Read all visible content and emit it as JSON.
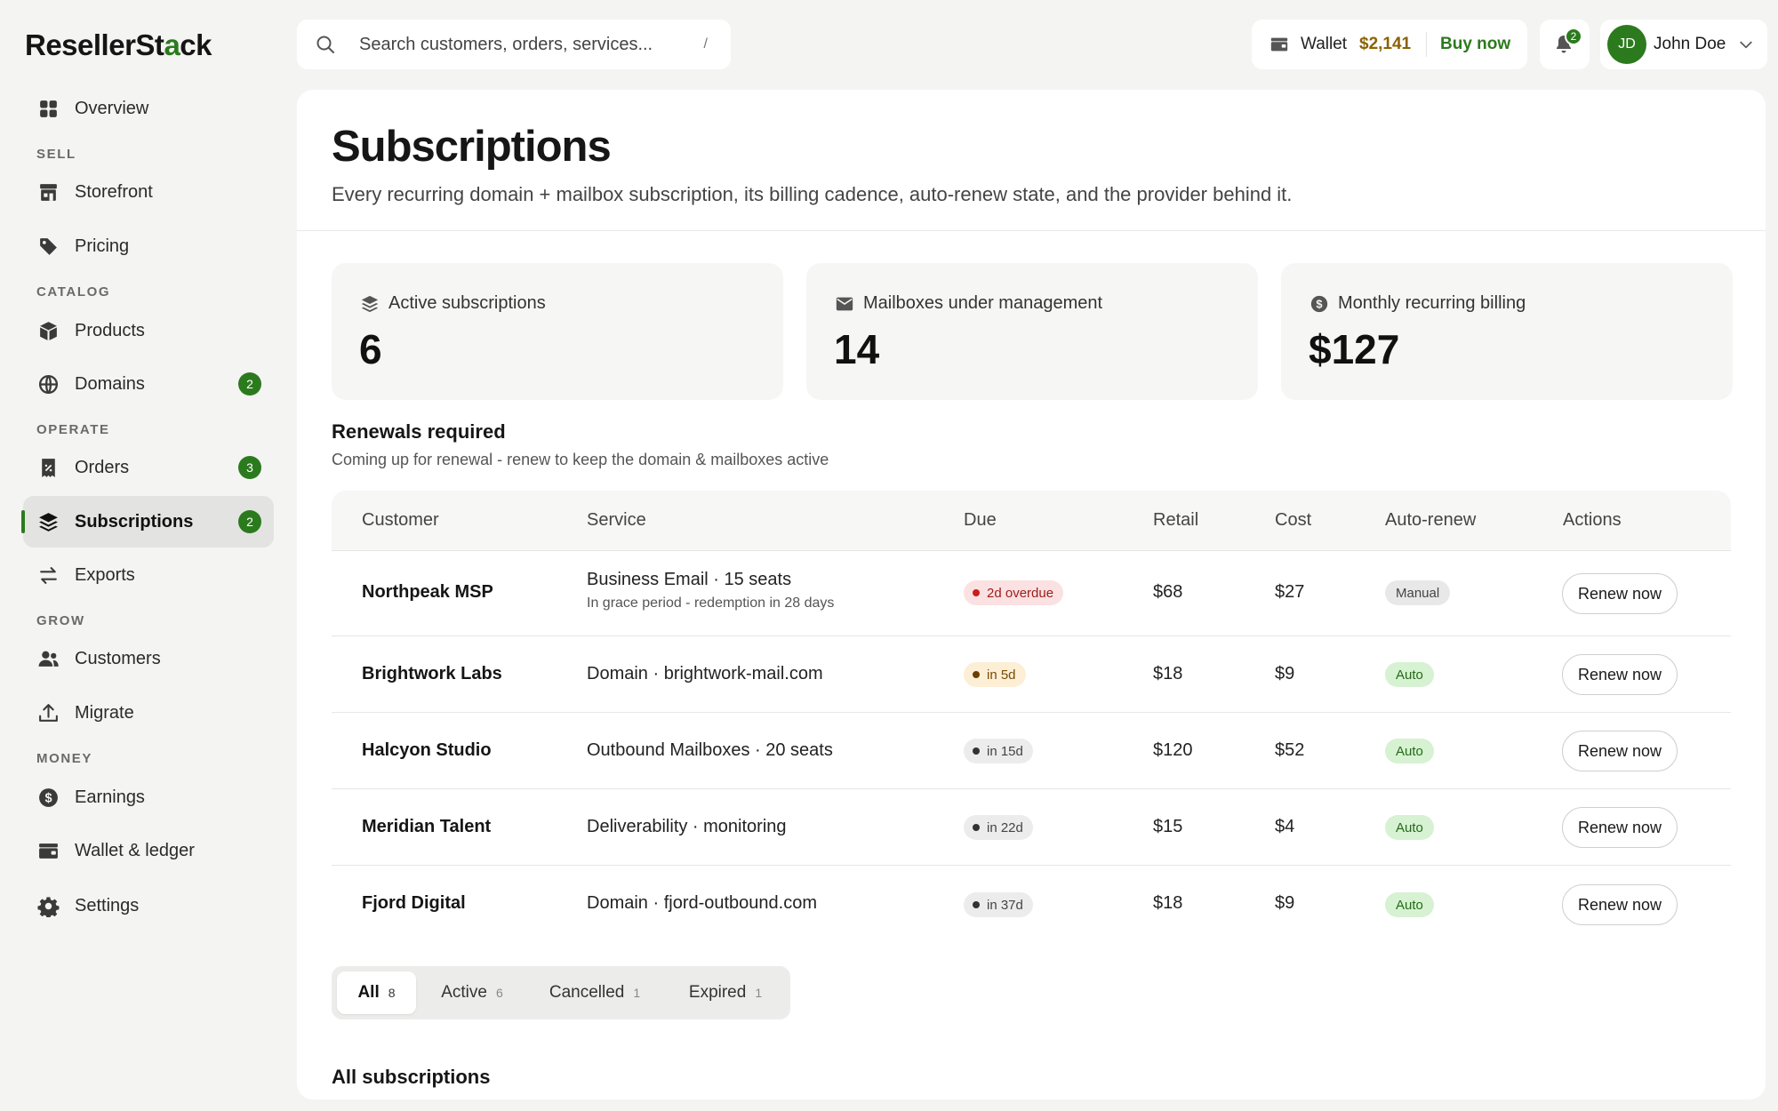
{
  "app": {
    "logo_text_a": "ResellerSt",
    "logo_text_b": "a",
    "logo_text_c": "ck"
  },
  "sidebar": {
    "items": [
      {
        "label": "Overview",
        "icon": "grid-icon"
      },
      {
        "label": "Storefront",
        "icon": "storefront-icon"
      },
      {
        "label": "Pricing",
        "icon": "tag-icon"
      },
      {
        "label": "Products",
        "icon": "box-icon"
      },
      {
        "label": "Domains",
        "icon": "globe-icon",
        "badge": "2"
      },
      {
        "label": "Orders",
        "icon": "receipt-icon",
        "badge": "3"
      },
      {
        "label": "Subscriptions",
        "icon": "layers-icon",
        "badge": "2",
        "active": true
      },
      {
        "label": "Exports",
        "icon": "arrows-icon"
      },
      {
        "label": "Customers",
        "icon": "users-icon"
      },
      {
        "label": "Migrate",
        "icon": "upload-icon"
      },
      {
        "label": "Earnings",
        "icon": "dollar-icon"
      },
      {
        "label": "Wallet & ledger",
        "icon": "wallet-icon"
      },
      {
        "label": "Settings",
        "icon": "gear-icon"
      }
    ],
    "sections": {
      "sell": "SELL",
      "catalog": "CATALOG",
      "operate": "OPERATE",
      "grow": "GROW",
      "money": "MONEY"
    }
  },
  "topbar": {
    "search_placeholder": "Search customers, orders, services...",
    "search_shortcut": "/",
    "wallet_label": "Wallet",
    "wallet_amount": "$2,141",
    "buy_now": "Buy now",
    "notifications_count": "2",
    "user_initials": "JD",
    "user_name": "John Doe"
  },
  "page": {
    "title": "Subscriptions",
    "subtitle": "Every recurring domain + mailbox subscription, its billing cadence, auto-renew state, and the provider behind it."
  },
  "stats": [
    {
      "label": "Active subscriptions",
      "value": "6",
      "icon": "layers-icon"
    },
    {
      "label": "Mailboxes under management",
      "value": "14",
      "icon": "mail-icon"
    },
    {
      "label": "Monthly recurring billing",
      "value": "$127",
      "icon": "dollar-icon"
    }
  ],
  "renewals": {
    "title": "Renewals required",
    "subtitle": "Coming up for renewal - renew to keep the domain & mailboxes active",
    "columns": [
      "Customer",
      "Service",
      "Due",
      "Retail",
      "Cost",
      "Auto-renew",
      "Actions"
    ],
    "rows": [
      {
        "customer": "Northpeak MSP",
        "service": "Business Email · 15 seats",
        "note": "In grace period - redemption in 28 days",
        "due": "2d overdue",
        "due_tone": "red",
        "retail": "$68",
        "cost": "$27",
        "autorenew": "Manual",
        "action": "Renew now"
      },
      {
        "customer": "Brightwork Labs",
        "service": "Domain · brightwork-mail.com",
        "note": "",
        "due": "in 5d",
        "due_tone": "amber",
        "retail": "$18",
        "cost": "$9",
        "autorenew": "Auto",
        "action": "Renew now"
      },
      {
        "customer": "Halcyon Studio",
        "service": "Outbound Mailboxes · 20 seats",
        "note": "",
        "due": "in 15d",
        "due_tone": "gray",
        "retail": "$120",
        "cost": "$52",
        "autorenew": "Auto",
        "action": "Renew now"
      },
      {
        "customer": "Meridian Talent",
        "service": "Deliverability · monitoring",
        "note": "",
        "due": "in 22d",
        "due_tone": "gray",
        "retail": "$15",
        "cost": "$4",
        "autorenew": "Auto",
        "action": "Renew now"
      },
      {
        "customer": "Fjord Digital",
        "service": "Domain · fjord-outbound.com",
        "note": "",
        "due": "in 37d",
        "due_tone": "gray",
        "retail": "$18",
        "cost": "$9",
        "autorenew": "Auto",
        "action": "Renew now"
      }
    ]
  },
  "filters": {
    "tabs": [
      {
        "label": "All",
        "count": "8",
        "active": true
      },
      {
        "label": "Active",
        "count": "6"
      },
      {
        "label": "Cancelled",
        "count": "1"
      },
      {
        "label": "Expired",
        "count": "1"
      }
    ]
  },
  "all_subscriptions": {
    "title": "All subscriptions"
  },
  "colors": {
    "accent": "#2c7a1e",
    "wallet_amount": "#8a6200",
    "overdue": "#c81e1e"
  }
}
